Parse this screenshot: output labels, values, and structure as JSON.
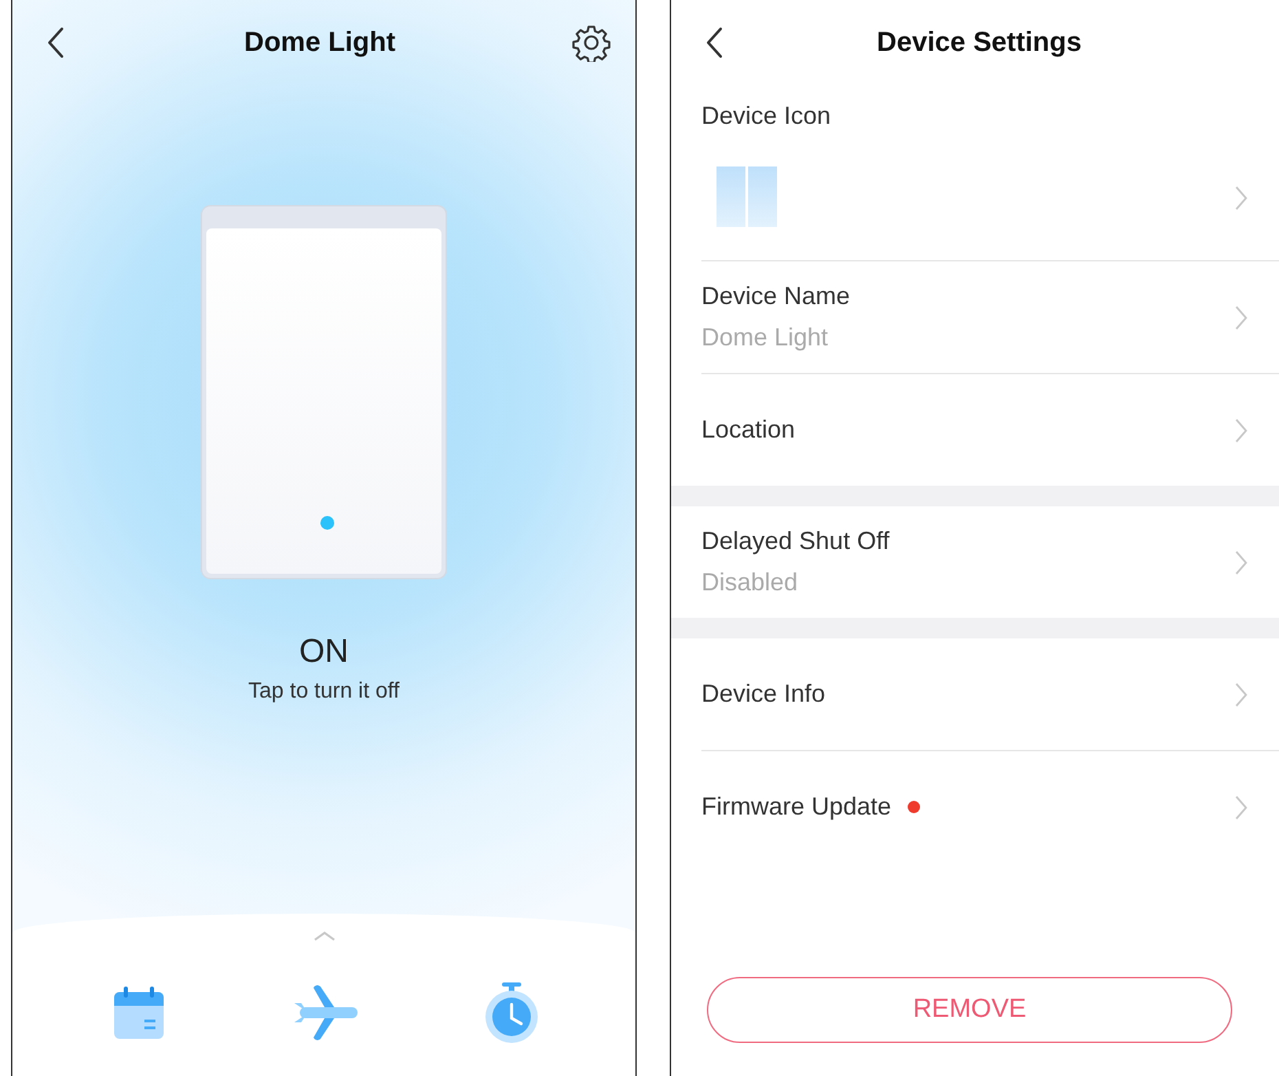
{
  "control_screen": {
    "title": "Dome Light",
    "switch": {
      "on": true
    },
    "state_label": "ON",
    "hint": "Tap to turn it off",
    "toolbar": [
      {
        "kind": "schedule"
      },
      {
        "kind": "away"
      },
      {
        "kind": "timer"
      }
    ]
  },
  "settings_screen": {
    "title": "Device Settings",
    "sections": [
      {
        "items": [
          {
            "kind": "icon",
            "label": "Device Icon"
          },
          {
            "kind": "text",
            "label": "Device Name",
            "value": "Dome Light"
          },
          {
            "kind": "text",
            "label": "Location"
          }
        ]
      },
      {
        "items": [
          {
            "kind": "text",
            "label": "Delayed Shut Off",
            "value": "Disabled"
          }
        ]
      },
      {
        "items": [
          {
            "kind": "text",
            "label": "Device Info"
          },
          {
            "kind": "text",
            "label": "Firmware Update",
            "update_badge": true
          }
        ]
      }
    ],
    "remove_button": "REMOVE"
  }
}
